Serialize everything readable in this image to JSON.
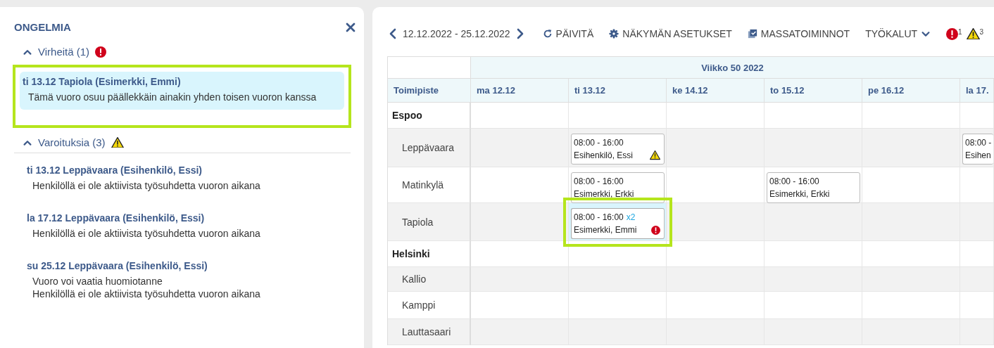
{
  "problems": {
    "title": "ONGELMIA",
    "sections": [
      {
        "kind": "error",
        "label": "Virheitä (1)",
        "expanded": true,
        "items": [
          {
            "title": "ti 13.12 Tapiola (Esimerkki, Emmi)",
            "messages": [
              "Tämä vuoro osuu päällekkäin ainakin yhden toisen vuoron kanssa"
            ],
            "selected": true
          }
        ]
      },
      {
        "kind": "warning",
        "label": "Varoituksia (3)",
        "expanded": true,
        "items": [
          {
            "title": "ti 13.12 Leppävaara (Esihenkilö, Essi)",
            "messages": [
              "Henkilöllä ei ole aktiivista työsuhdetta vuoron aikana"
            ],
            "selected": false
          },
          {
            "title": "la 17.12 Leppävaara (Esihenkilö, Essi)",
            "messages": [
              "Henkilöllä ei ole aktiivista työsuhdetta vuoron aikana"
            ],
            "selected": false
          },
          {
            "title": "su 25.12 Leppävaara (Esihenkilö, Essi)",
            "messages": [
              "Vuoro voi vaatia huomiotanne",
              "Henkilöllä ei ole aktiivista työsuhdetta vuoron aikana"
            ],
            "selected": false
          }
        ]
      }
    ]
  },
  "toolbar": {
    "date_range": "12.12.2022 - 25.12.2022",
    "refresh": "PÄIVITÄ",
    "view_settings": "NÄKYMÄN ASETUKSET",
    "bulk_actions": "MASSATOIMINNOT",
    "tools": "TYÖKALUT",
    "error_count": "1",
    "warning_count": "3"
  },
  "schedule": {
    "week": "Viikko 50 2022",
    "location_header": "Toimipiste",
    "days": [
      "ma 12.12",
      "ti 13.12",
      "ke 14.12",
      "to 15.12",
      "pe 16.12",
      "la 17."
    ],
    "rows": [
      {
        "kind": "group",
        "name": "Espoo",
        "cells": [
          {},
          {},
          {},
          {},
          {},
          {}
        ]
      },
      {
        "kind": "location",
        "name": "Leppävaara",
        "cells": [
          {},
          {
            "time": "08:00 - 16:00",
            "person": "Esihenkilö, Essi",
            "kind": "warning",
            "selected": false
          },
          {},
          {},
          {},
          {
            "time": "08:00 -",
            "person": "Esihen",
            "kind": "plain",
            "selected": false
          }
        ]
      },
      {
        "kind": "location",
        "name": "Matinkylä",
        "cells": [
          {},
          {
            "time": "08:00 - 16:00",
            "person": "Esimerkki, Erkki",
            "kind": "plain",
            "selected": false
          },
          {},
          {
            "time": "08:00 - 16:00",
            "person": "Esimerkki, Erkki",
            "kind": "plain",
            "selected": false
          },
          {},
          {}
        ]
      },
      {
        "kind": "location",
        "name": "Tapiola",
        "cells": [
          {},
          {
            "time": "08:00 - 16:00",
            "count": "x2",
            "person": "Esimerkki, Emmi",
            "kind": "error",
            "selected": true
          },
          {},
          {},
          {},
          {}
        ]
      },
      {
        "kind": "group",
        "name": "Helsinki",
        "cells": [
          {},
          {},
          {},
          {},
          {},
          {}
        ]
      },
      {
        "kind": "location",
        "name": "Kallio",
        "cells": [
          {},
          {},
          {},
          {},
          {},
          {}
        ]
      },
      {
        "kind": "location",
        "name": "Kamppi",
        "cells": [
          {},
          {},
          {},
          {},
          {},
          {}
        ]
      },
      {
        "kind": "location",
        "name": "Lauttasaari",
        "cells": [
          {},
          {},
          {},
          {},
          {},
          {}
        ]
      }
    ]
  }
}
